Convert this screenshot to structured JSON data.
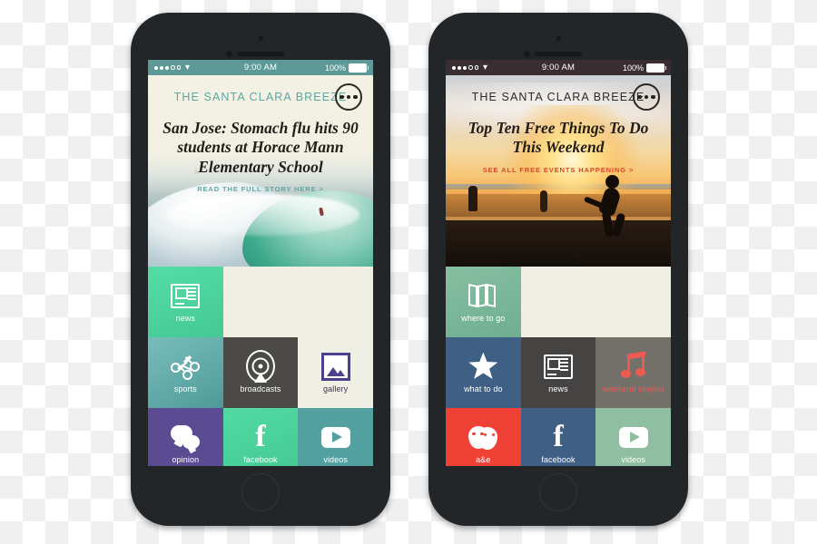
{
  "scene": {
    "description": "Two iPhone mockups side by side showing a news app",
    "background": "transparency-checkerboard"
  },
  "colors": {
    "mint": "#4fd7a0",
    "teal": "#6cb3b0",
    "teal_dark": "#4f9b98",
    "purple": "#5a4b92",
    "gallery_purple": "#4b3f8f",
    "dark_gray": "#4a4a48",
    "sage": "#7fb89b",
    "slate_blue": "#3f5f85",
    "red": "#ef4136",
    "coral": "#ec5a52",
    "videos_green": "#8fbfa0",
    "statusbar_left": "#5d9a97",
    "statusbar_right": "#3a2e33",
    "cta_teal": "#5fa6a3",
    "cta_red": "#e0442e"
  },
  "phones": [
    {
      "id": "left",
      "status_bar": {
        "signal_dots": 5,
        "signal_filled": 3,
        "wifi_icon": "wifi-icon",
        "time": "9:00 AM",
        "battery_percent": "100%",
        "battery_icon": "battery-full-icon"
      },
      "nav": {
        "masthead": "THE SANTA CLARA BREEZE",
        "menu_icon": "more-dots-icon"
      },
      "hero": {
        "headline": "San Jose: Stomach flu hits 90 students at Horace Mann Elementary School",
        "cta": "READ THE FULL STORY HERE >",
        "image_description": "ocean-wave-surfer-photo"
      },
      "tiles": [
        {
          "label": "news",
          "icon": "newspaper-icon",
          "style": "mint"
        },
        {
          "label": "",
          "icon": "",
          "style": "transparent"
        },
        {
          "label": "",
          "icon": "",
          "style": "transparent"
        },
        {
          "label": "sports",
          "icon": "playbook-icon",
          "style": "teal"
        },
        {
          "label": "broadcasts",
          "icon": "broadcast-icon",
          "style": "dark-gray"
        },
        {
          "label": "gallery",
          "icon": "photo-icon",
          "style": "transparent-purple"
        },
        {
          "label": "opinion",
          "icon": "speech-bubbles-icon",
          "style": "purple"
        },
        {
          "label": "facebook",
          "icon": "facebook-icon",
          "style": "mint"
        },
        {
          "label": "videos",
          "icon": "play-icon",
          "style": "teal-dark"
        }
      ]
    },
    {
      "id": "right",
      "status_bar": {
        "signal_dots": 5,
        "signal_filled": 3,
        "wifi_icon": "wifi-icon",
        "time": "9:00 AM",
        "battery_percent": "100%",
        "battery_icon": "battery-full-icon"
      },
      "nav": {
        "masthead": "THE SANTA CLARA BREEZE",
        "menu_icon": "more-dots-icon"
      },
      "hero": {
        "headline": "Top Ten Free Things To Do This Weekend",
        "cta": "SEE ALL FREE EVENTS HAPPENING >",
        "image_description": "sunset-beach-skateboarder-photo"
      },
      "tiles": [
        {
          "label": "where to go",
          "icon": "map-icon",
          "style": "sage"
        },
        {
          "label": "",
          "icon": "",
          "style": "transparent"
        },
        {
          "label": "",
          "icon": "",
          "style": "transparent"
        },
        {
          "label": "what to do",
          "icon": "star-icon",
          "style": "slate-blue"
        },
        {
          "label": "news",
          "icon": "newspaper-icon",
          "style": "dark-gray"
        },
        {
          "label": "weekend playlist",
          "icon": "music-note-icon",
          "style": "transparent-red"
        },
        {
          "label": "a&e",
          "icon": "theatre-masks-icon",
          "style": "red"
        },
        {
          "label": "facebook",
          "icon": "facebook-icon",
          "style": "slate-blue"
        },
        {
          "label": "videos",
          "icon": "play-icon",
          "style": "videos-green"
        }
      ]
    }
  ]
}
